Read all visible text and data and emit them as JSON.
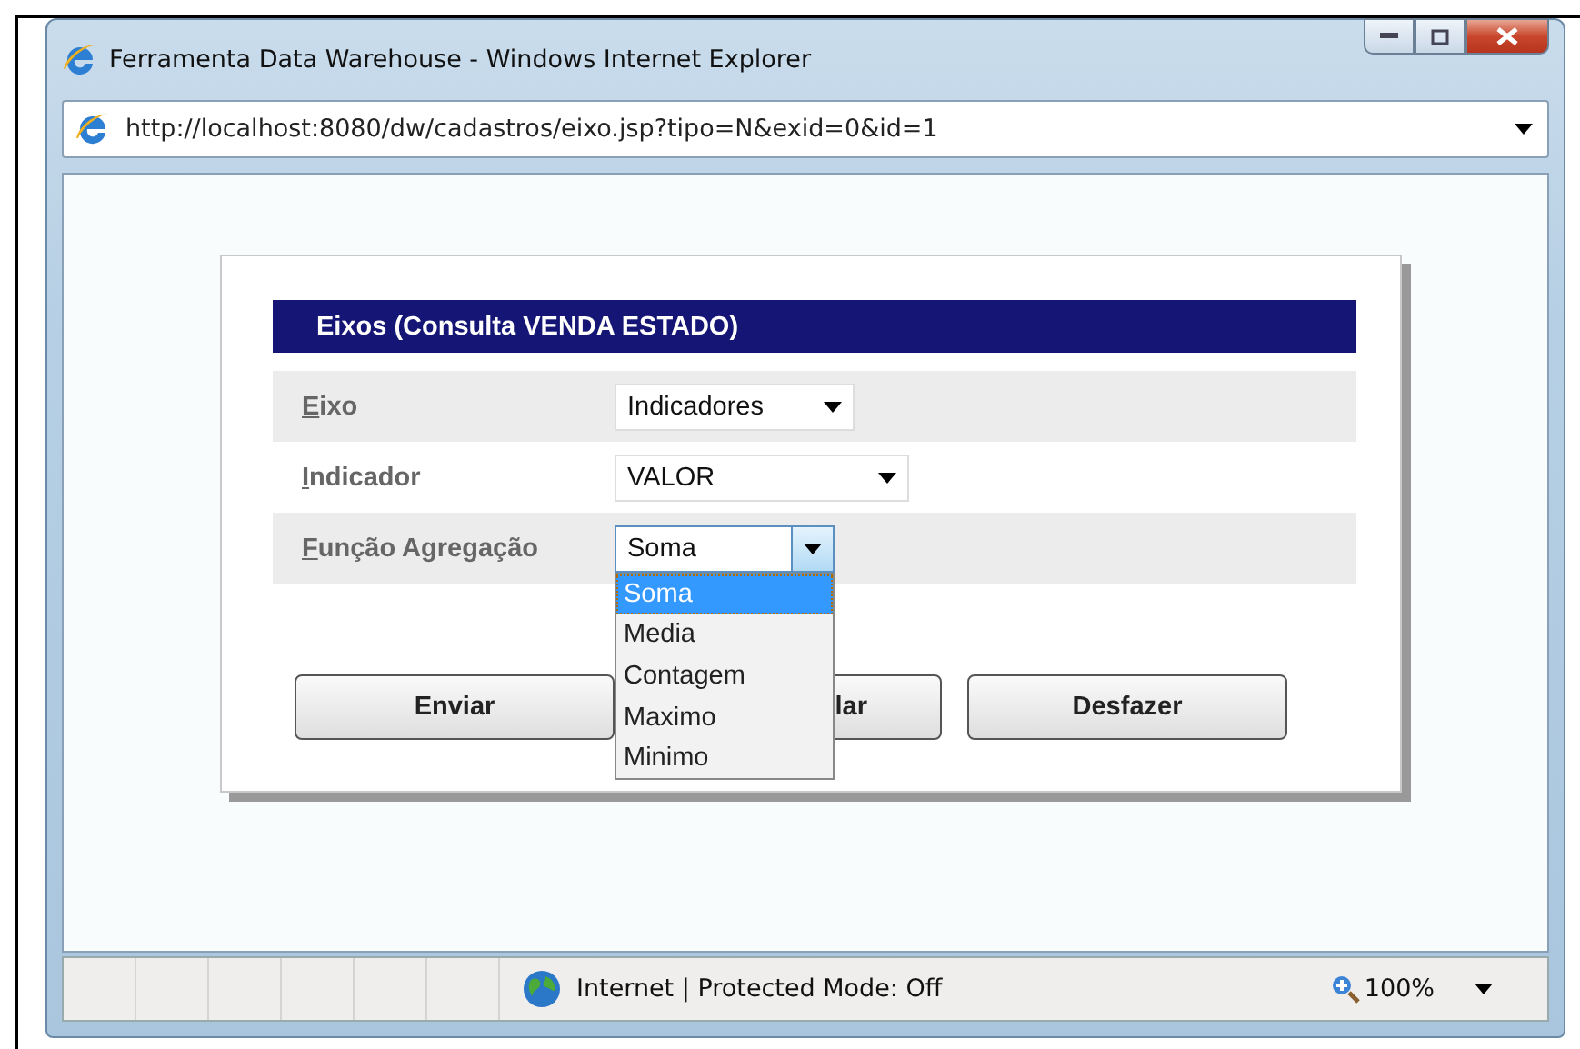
{
  "window": {
    "title": "Ferramenta Data Warehouse - Windows Internet Explorer",
    "address": "http://localhost:8080/dw/cadastros/eixo.jsp?tipo=N&exid=0&id=1"
  },
  "form": {
    "title": "Eixos (Consulta VENDA ESTADO)",
    "fields": [
      {
        "label": "Eixo",
        "value": "Indicadores",
        "dropdown_open": false
      },
      {
        "label": "Indicador",
        "value": "VALOR",
        "dropdown_open": false
      },
      {
        "label": "Função Agregação",
        "value": "Soma",
        "dropdown_open": true
      }
    ],
    "options": [
      {
        "label": "Soma",
        "selected": true
      },
      {
        "label": "Media",
        "selected": false
      },
      {
        "label": "Contagem",
        "selected": false
      },
      {
        "label": "Maximo",
        "selected": false
      },
      {
        "label": "Minimo",
        "selected": false
      }
    ],
    "buttons": [
      "Enviar",
      "lar",
      "Desfazer"
    ]
  },
  "status_bar": {
    "zone": "Internet | Protected Mode: Off",
    "zoom": "100%"
  }
}
